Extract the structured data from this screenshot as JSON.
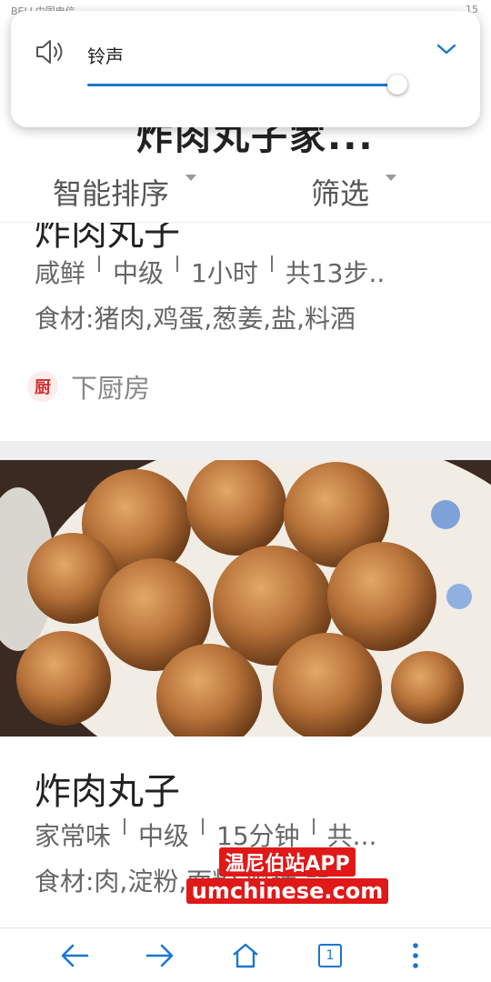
{
  "status_bar": {
    "carrier": "BELL中国电信",
    "time": "15"
  },
  "page": {
    "title": "炸肉丸子家..."
  },
  "sort_bar": {
    "smart_sort": "智能排序",
    "filter": "筛选"
  },
  "cards": [
    {
      "title": "炸肉丸子",
      "meta": [
        "咸鲜",
        "中级",
        "1小时",
        "共13步.."
      ],
      "ingredients": "食材:猪肉,鸡蛋,葱姜,盐,料酒",
      "source_logo": "厨",
      "source": "下厨房"
    },
    {
      "title": "炸肉丸子",
      "meta": [
        "家常味",
        "中级",
        "15分钟",
        "共..."
      ],
      "ingredients": "食材:肉,淀粉,面粉,鸡精,蒜..."
    }
  ],
  "watermark": {
    "line1": "温尼伯站APP",
    "line2": "umchinese.com"
  },
  "bottom_nav": {
    "tab_count": "1",
    "icons": [
      "back-arrow-icon",
      "forward-arrow-icon",
      "home-icon",
      "tabs-icon",
      "more-menu-icon"
    ]
  },
  "volume": {
    "label": "铃声",
    "level": 0.97,
    "accent": "#1976d2"
  }
}
